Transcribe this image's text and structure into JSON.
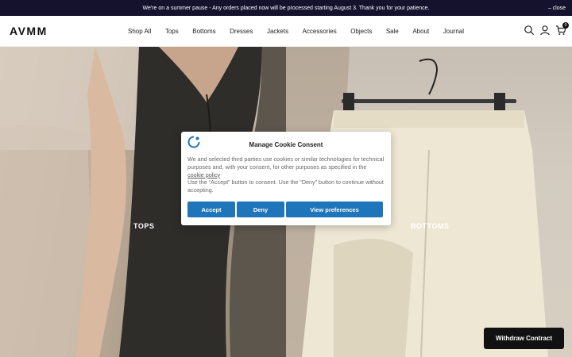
{
  "announcement": {
    "text": "We're on a summer pause - Any orders placed now will be processed starting August 3. Thank you for your patience.",
    "close_label": "– close"
  },
  "header": {
    "logo": "AVMM",
    "nav": [
      "Shop All",
      "Tops",
      "Bottoms",
      "Dresses",
      "Jackets",
      "Accessories",
      "Objects",
      "Sale",
      "About",
      "Journal"
    ],
    "icons": [
      "search-icon",
      "account-icon",
      "cart-icon"
    ],
    "cart_count": "0"
  },
  "hero": {
    "left_label": "TOPS",
    "right_label": "BOTTOMS"
  },
  "cookie_modal": {
    "title": "Manage Cookie Consent",
    "body_1": "We and selected third parties use cookies or similar technologies for technical purposes and, with your consent, for other purposes as specified in the ",
    "policy_link": "cookie policy",
    "body_2": "Use the “Accept” button to consent. Use the “Deny” button to continue without accepting.",
    "accept_label": "Accept",
    "deny_label": "Deny",
    "preferences_label": "View preferences",
    "accent_color": "#1f75b9"
  },
  "withdraw_label": "Withdraw Contract"
}
